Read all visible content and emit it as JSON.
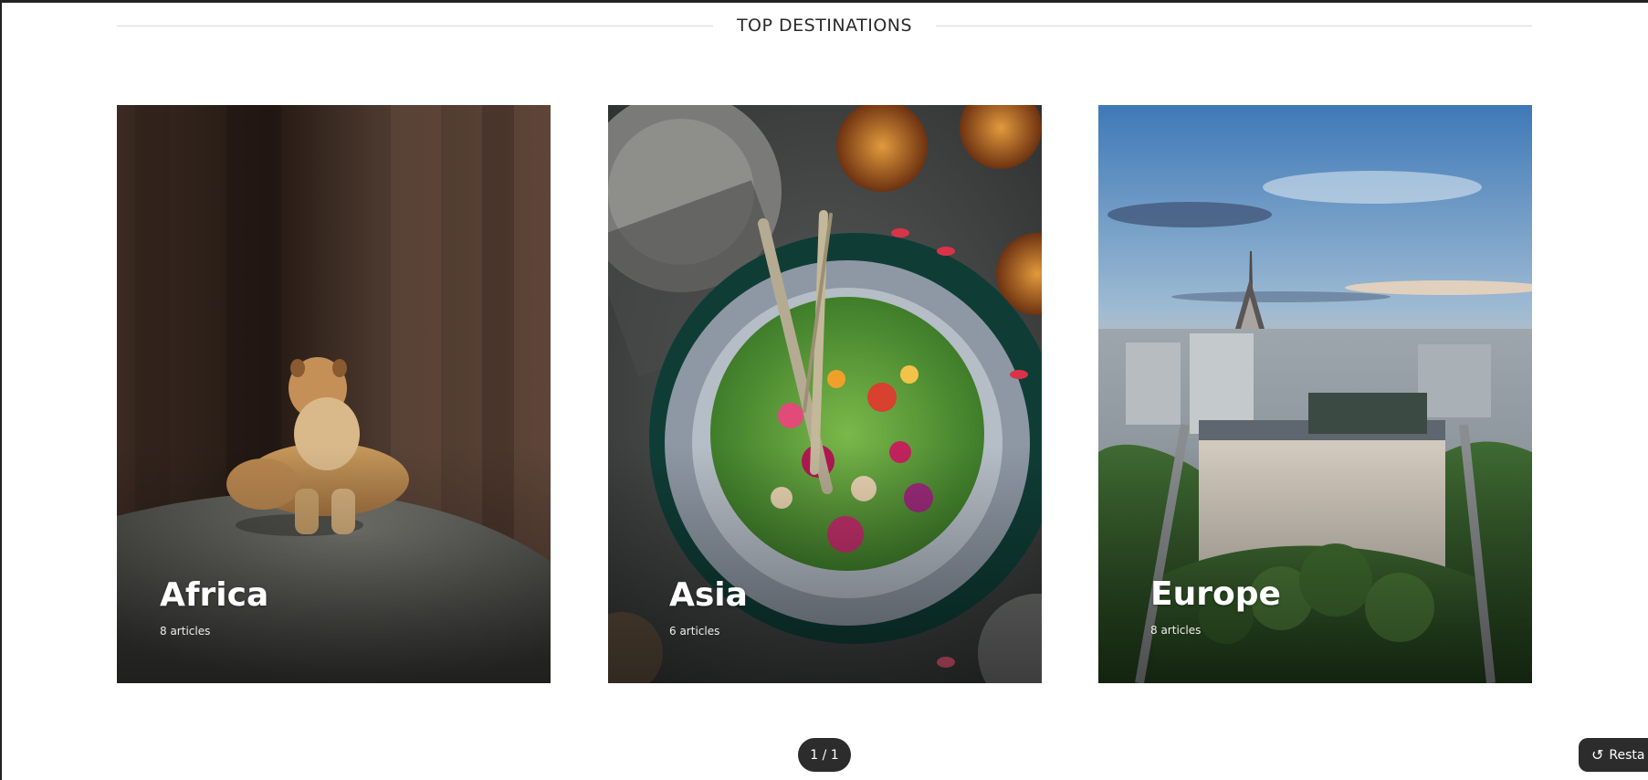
{
  "section": {
    "title": "TOP DESTINATIONS"
  },
  "cards": [
    {
      "name": "Africa",
      "count": "8 articles",
      "image": "lioness-on-rock"
    },
    {
      "name": "Asia",
      "count": "6 articles",
      "image": "green-salad-bowl"
    },
    {
      "name": "Europe",
      "count": "8 articles",
      "image": "paris-eiffel-tower"
    }
  ],
  "pager": {
    "label": "1 / 1"
  },
  "restart": {
    "label": "Resta",
    "icon": "undo-icon"
  }
}
